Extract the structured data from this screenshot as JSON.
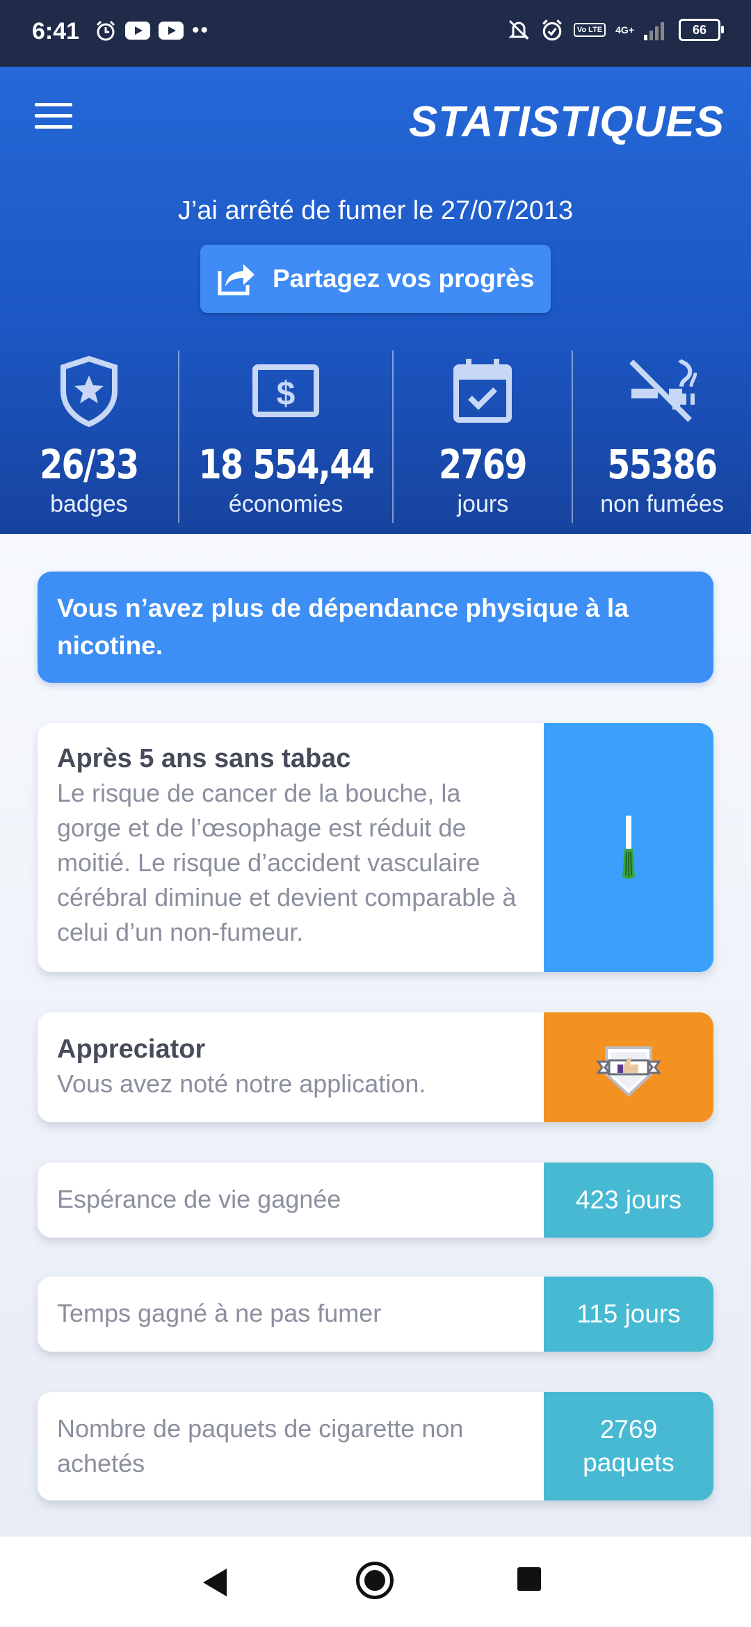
{
  "status_bar": {
    "time": "6:41",
    "network": "4G+",
    "volte": "Vo LTE",
    "battery": "66",
    "icons_left": [
      "alarm-icon",
      "youtube-icon",
      "youtube-icon",
      "more-dots-icon"
    ],
    "icons_right": [
      "silent-bell-icon",
      "alarm-icon",
      "volte-icon",
      "signal-icon",
      "battery-icon"
    ]
  },
  "header": {
    "title": "STATISTIQUES",
    "quit_date_text": "J’ai arrêté de fumer le 27/07/2013",
    "share_button_label": "Partagez vos progrès",
    "colors": {
      "background": "#1c57c4",
      "button": "#3f8cf6"
    }
  },
  "stats": [
    {
      "icon": "badge-shield-icon",
      "value": "26/33",
      "label": "badges"
    },
    {
      "icon": "dollar-bill-icon",
      "value": "18 554,44",
      "label": "économies"
    },
    {
      "icon": "calendar-check-icon",
      "value": "2769",
      "label": "jours"
    },
    {
      "icon": "no-smoking-icon",
      "value": "55386",
      "label": "non fumées"
    }
  ],
  "notice": {
    "text": "Vous n’avez plus de dépendance physique à la nicotine."
  },
  "milestone_card": {
    "title": "Après 5 ans sans tabac",
    "body": "Le risque de cancer de la bouche, la gorge et de l’œsophage est réduit de moitié. Le risque d’accident vasculaire cérébral diminue et devient comparable à celui d’un non-fumeur.",
    "side_icon": "cigarette-progress-icon",
    "side_color": "#3aa0fb"
  },
  "badge_card": {
    "title": "Appreciator",
    "body": "Vous avez noté notre application.",
    "side_icon": "thumbs-up-badge-icon",
    "side_color": "#f39221"
  },
  "stat_rows": [
    {
      "label": "Espérance de vie gagnée",
      "value": "423 jours"
    },
    {
      "label": "Temps gagné à ne pas fumer",
      "value": "115 jours"
    },
    {
      "label": "Nombre de paquets de cigarette non achetés",
      "value": "2769 paquets"
    }
  ],
  "stat_row_color": "#47b9d2",
  "nav_bar": [
    "back-icon",
    "home-icon",
    "recents-icon"
  ]
}
